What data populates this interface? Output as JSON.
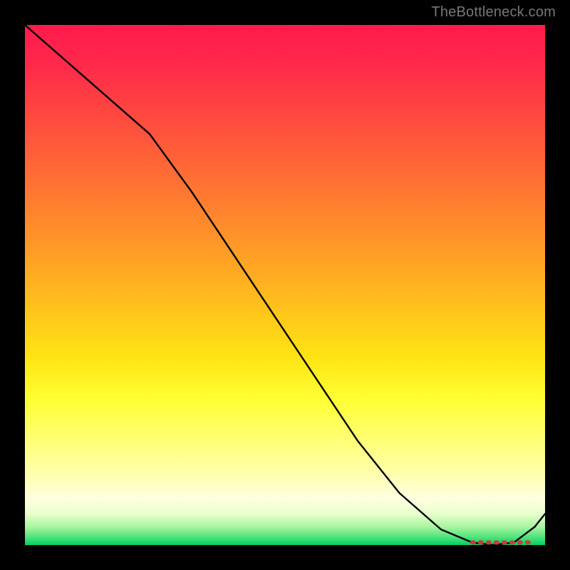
{
  "attribution": "TheBottleneck.com",
  "chart_data": {
    "type": "line",
    "title": "",
    "xlabel": "",
    "ylabel": "",
    "xlim": [
      0,
      100
    ],
    "ylim": [
      0,
      100
    ],
    "x": [
      0,
      8,
      16,
      24,
      32,
      40,
      48,
      56,
      64,
      72,
      80,
      86,
      90,
      94,
      98,
      100
    ],
    "values": [
      100,
      93,
      86,
      79,
      68,
      56,
      44,
      32,
      20,
      10,
      3,
      0.5,
      0,
      0.5,
      3.5,
      6
    ],
    "marker_region": {
      "x_start": 86,
      "x_end": 98,
      "y": 0.5
    },
    "gradient_stops": [
      {
        "pos": 0.0,
        "color": "#ff1a4d"
      },
      {
        "pos": 0.5,
        "color": "#ffc81a"
      },
      {
        "pos": 0.75,
        "color": "#ffff33"
      },
      {
        "pos": 0.93,
        "color": "#ffffe0"
      },
      {
        "pos": 1.0,
        "color": "#00d060"
      }
    ]
  }
}
